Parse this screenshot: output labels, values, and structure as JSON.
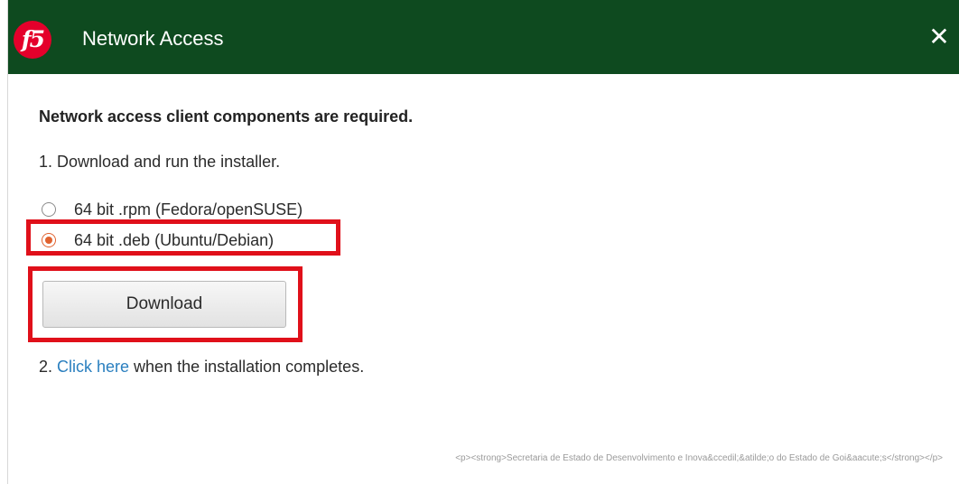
{
  "window": {
    "title": "Network Access",
    "logo_text": "f5",
    "close_glyph": "✕"
  },
  "content": {
    "heading": "Network access client components are required.",
    "step1": "1. Download and run the installer.",
    "options": [
      {
        "label": "64 bit .rpm (Fedora/openSUSE)",
        "selected": false
      },
      {
        "label": "64 bit .deb (Ubuntu/Debian)",
        "selected": true
      }
    ],
    "download_button": "Download",
    "step2_prefix": "2. ",
    "step2_link": "Click here",
    "step2_suffix": " when the installation completes."
  },
  "footer": {
    "note": "<p><strong>Secretaria de Estado de Desenvolvimento e Inova&ccedil;&atilde;o do Estado de Goi&aacute;s</strong></p>"
  },
  "colors": {
    "titlebar": "#0e4a1f",
    "logo": "#e4002b",
    "radio_accent": "#e0622f",
    "highlight": "#e0101a",
    "link": "#2a7fbf"
  },
  "icons": {
    "logo": "f5-logo-icon",
    "close": "close-icon"
  }
}
